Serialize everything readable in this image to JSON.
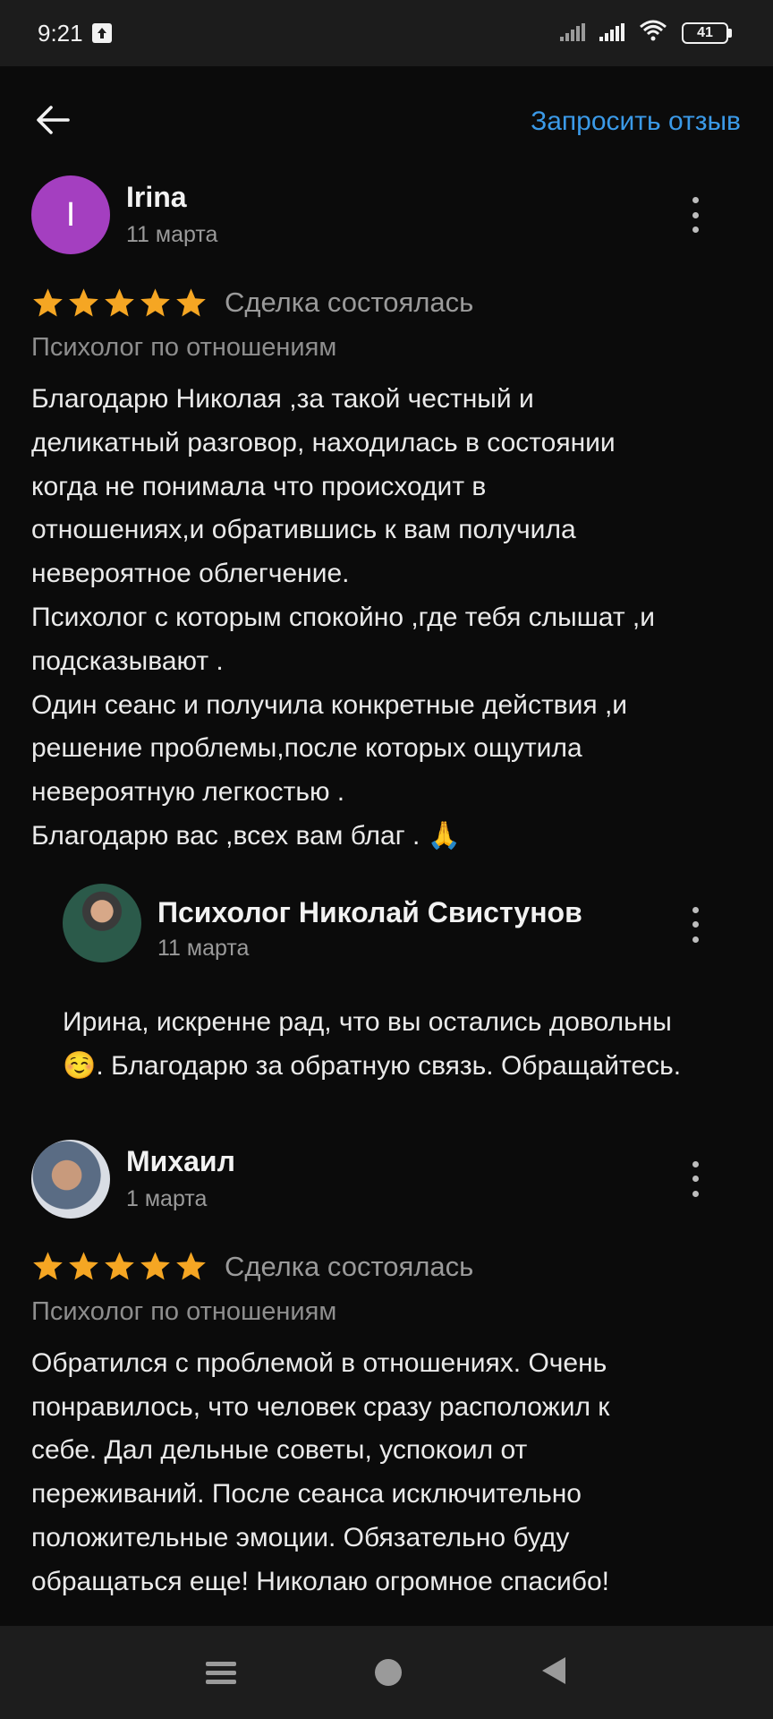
{
  "status_bar": {
    "time": "9:21",
    "battery": "41"
  },
  "header": {
    "back_icon": "arrow-left-icon",
    "request_review": "Запросить отзыв"
  },
  "reviews": [
    {
      "avatar_letter": "I",
      "avatar_color": "#a43fc0",
      "author": "Irina",
      "date": "11 марта",
      "stars": 5,
      "deal_status": "Сделка состоялась",
      "category": "Психолог по отношениям",
      "text": "Благодарю Николая ,за такой честный и\nделикатный разговор, находилась в состоянии\nкогда не понимала что происходит в\nотношениях,и обратившись к вам получила\nневероятное облегчение.\nПсихолог с которым спокойно ,где тебя слышат ,и\nподсказывают .\nОдин сеанс и получила конкретные действия ,и\nрешение проблемы,после которых ощутила\nневероятную легкостью .\nБлагодарю вас ,всех вам благ . 🙏",
      "reply": {
        "author": "Психолог Николай Свистунов",
        "date": "11 марта",
        "text": "Ирина,  искренне рад, что вы остались довольны☺️. Благодарю за обратную связь. Обращайтесь."
      }
    },
    {
      "author": "Михаил",
      "date": "1 марта",
      "stars": 5,
      "deal_status": "Сделка состоялась",
      "category": "Психолог по отношениям",
      "text": "Обратился с проблемой в отношениях. Очень\nпонравилось, что человек сразу расположил к\nсебе. Дал дельные советы, успокоил от\nпереживаний. После сеанса исключительно\nположительные эмоции. Обязательно буду\nобращаться еще! Николаю огромное спасибо!"
    }
  ],
  "colors": {
    "accent": "#3b9ae8",
    "star": "#f5a623",
    "background": "#0b0b0b"
  },
  "nav": {
    "menu_icon": "menu-icon",
    "home_icon": "home-circle-icon",
    "back_icon": "triangle-back-icon"
  }
}
